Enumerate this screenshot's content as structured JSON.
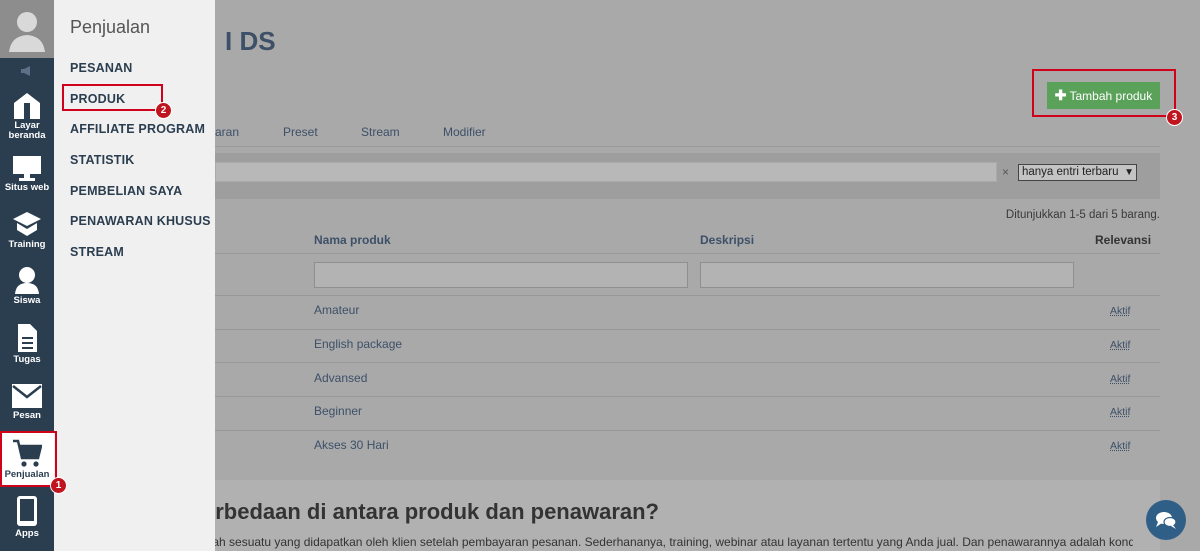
{
  "rail": {
    "items": [
      {
        "label": "Layar\nberanda",
        "icon": "home-icon"
      },
      {
        "label": "Situs web",
        "icon": "monitor-icon"
      },
      {
        "label": "Training",
        "icon": "graduation-cap-icon"
      },
      {
        "label": "Siswa",
        "icon": "user-icon"
      },
      {
        "label": "Tugas",
        "icon": "document-icon"
      },
      {
        "label": "Pesan",
        "icon": "envelope-icon"
      },
      {
        "label": "Penjualan",
        "icon": "cart-icon"
      },
      {
        "label": "Apps",
        "icon": "phone-icon"
      }
    ],
    "layar_1": "Layar",
    "layar_2": "beranda"
  },
  "flyout": {
    "title": "Penjualan",
    "items": [
      "PESANAN",
      "PRODUK",
      "AFFILIATE PROGRAM",
      "STATISTIK",
      "PEMBELIAN SAYA",
      "PENAWARAN KHUSUS",
      "STREAM"
    ]
  },
  "annotations": {
    "step1": "1",
    "step2": "2",
    "step3": "3",
    "highlight_color": "#d0021b"
  },
  "main": {
    "title_fragment": "I DS",
    "add_button": "Tambah produk",
    "tabs": [
      "aran",
      "Preset",
      "Stream",
      "Modifier"
    ],
    "search_clear": "×",
    "filter_select": "hanya entri terbaru",
    "shown_count": "Ditunjukkan 1-5 dari 5 barang.",
    "table": {
      "headers": [
        "Nama produk",
        "Deskripsi",
        "Relevansi"
      ],
      "rows": [
        {
          "name": "Amateur",
          "status": "Aktif"
        },
        {
          "name": "English package",
          "status": "Aktif"
        },
        {
          "name": "Advansed",
          "status": "Aktif"
        },
        {
          "name": "Beginner",
          "status": "Aktif"
        },
        {
          "name": "Akses 30 Hari",
          "status": "Aktif"
        }
      ]
    },
    "faq_title": "erbedaan di antara produk dan penawaran?",
    "faq_text": "alah sesuatu yang didapatkan oleh klien setelah pembayaran pesanan. Sederhananya, training, webinar atau layanan tertentu yang Anda jual. Dan penawarannya adalah kondisi di"
  },
  "colors": {
    "rail_bg": "#2b3e50",
    "add_button_bg": "#5aa15a",
    "chat_bg": "#2f5f86"
  }
}
